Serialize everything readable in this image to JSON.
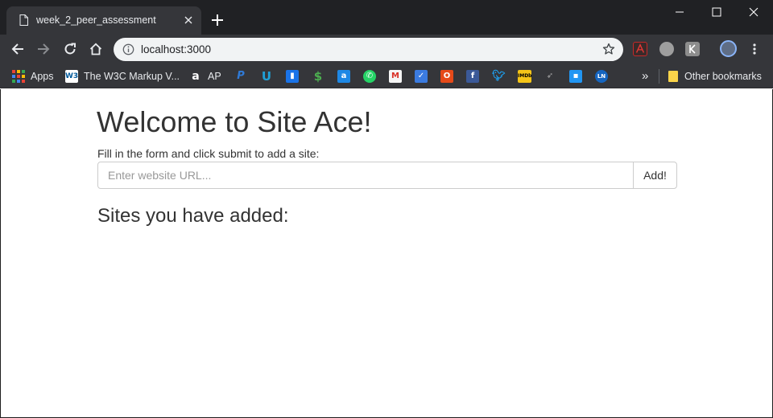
{
  "browser": {
    "tab": {
      "title": "week_2_peer_assessment"
    },
    "address": {
      "url": "localhost:3000"
    },
    "bookmarks": [
      {
        "icon": "apps-grid-icon",
        "label": "Apps"
      },
      {
        "icon": "w3c-icon",
        "label": "The W3C Markup V..."
      },
      {
        "icon": "amazon-icon",
        "label": "AP"
      },
      {
        "icon": "paypal-icon",
        "label": ""
      },
      {
        "icon": "upwork-icon",
        "label": ""
      },
      {
        "icon": "trello-icon",
        "label": ""
      },
      {
        "icon": "dollar-icon",
        "label": ""
      },
      {
        "icon": "appstore-icon",
        "label": ""
      },
      {
        "icon": "whatsapp-icon",
        "label": ""
      },
      {
        "icon": "gmail-icon",
        "label": ""
      },
      {
        "icon": "tasks-icon",
        "label": ""
      },
      {
        "icon": "office-icon",
        "label": ""
      },
      {
        "icon": "facebook-icon",
        "label": ""
      },
      {
        "icon": "twitter-icon",
        "label": ""
      },
      {
        "icon": "imdb-icon",
        "label": ""
      },
      {
        "icon": "eagle-icon",
        "label": ""
      },
      {
        "icon": "app-blue-icon",
        "label": ""
      },
      {
        "icon": "ln-icon",
        "label": ""
      }
    ],
    "overflow_label": "»",
    "other_bookmarks": "Other bookmarks"
  },
  "page": {
    "heading": "Welcome to Site Ace!",
    "instructions": "Fill in the form and click submit to add a site:",
    "url_input": {
      "placeholder": "Enter website URL...",
      "value": ""
    },
    "submit_label": "Add!",
    "sites_heading": "Sites you have added:"
  }
}
